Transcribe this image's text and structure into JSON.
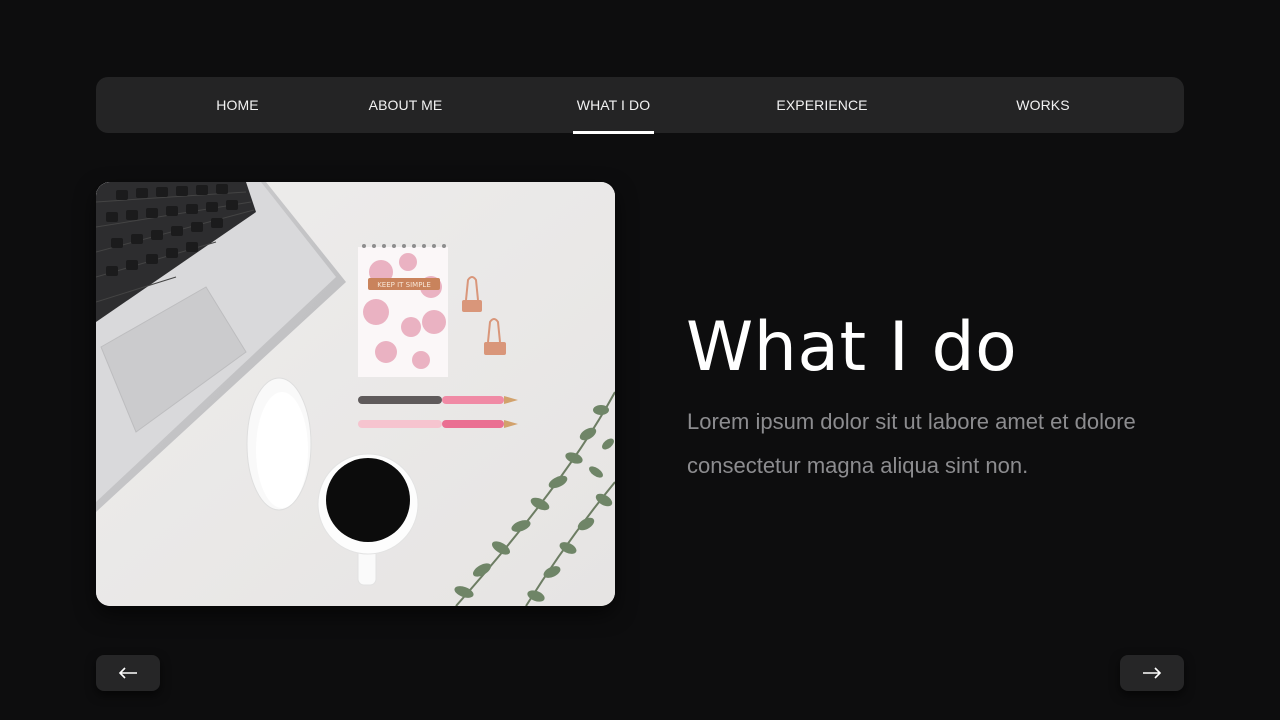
{
  "nav": {
    "items": [
      {
        "label": "HOME",
        "active": false
      },
      {
        "label": "ABOUT ME",
        "active": false
      },
      {
        "label": "WHAT I DO",
        "active": true
      },
      {
        "label": "EXPERIENCE",
        "active": false
      },
      {
        "label": "WORKS",
        "active": false
      }
    ]
  },
  "photo": {
    "alt": "Desk flat lay with laptop, notebook, pens, mouse, coffee and eucalyptus",
    "notebook_text": "KEEP IT SIMPLE"
  },
  "main": {
    "heading": "What I do",
    "body": "Lorem ipsum dolor sit ut labore amet et dolore consectetur magna aliqua sint non."
  },
  "controls": {
    "prev_icon": "arrow-left-icon",
    "next_icon": "arrow-right-icon"
  },
  "colors": {
    "background": "#0d0d0e",
    "nav_bg": "#242425",
    "body_text": "#8c8c8f"
  }
}
